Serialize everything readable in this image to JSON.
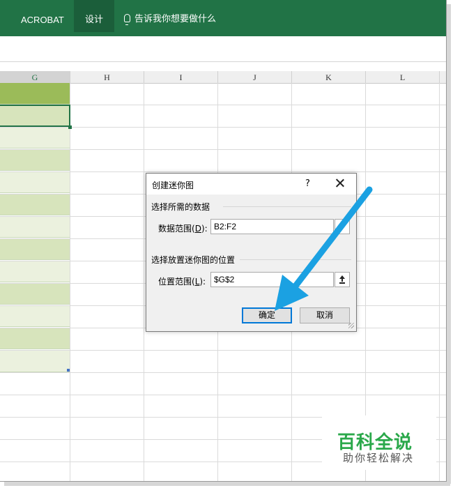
{
  "ribbon": {
    "tabs": [
      {
        "label": "ACROBAT"
      },
      {
        "label": "设计",
        "active": true
      }
    ],
    "tell_me": "告诉我你想要做什么",
    "color": "#217346"
  },
  "columns": [
    "G",
    "H",
    "I",
    "J",
    "K",
    "L"
  ],
  "dialog": {
    "title": "创建迷你图",
    "help": "?",
    "section_data": "选择所需的数据",
    "data_range_label": "数据范围(",
    "data_range_key": "D",
    "data_range_suffix": "):",
    "data_range_value": "B2:F2",
    "section_location": "选择放置迷你图的位置",
    "location_label": "位置范围(",
    "location_key": "L",
    "location_suffix": "):",
    "location_value": "$G$2",
    "ok": "确定",
    "cancel": "取消"
  },
  "watermark": {
    "main": "百科全说",
    "sub": "助你轻松解决"
  },
  "colors": {
    "header_green": "#9bbb59",
    "cell_green_dark": "#d7e4bc",
    "cell_green_light": "#ebf1de",
    "arrow_blue": "#1ba1e2",
    "ok_border": "#0078d7"
  }
}
